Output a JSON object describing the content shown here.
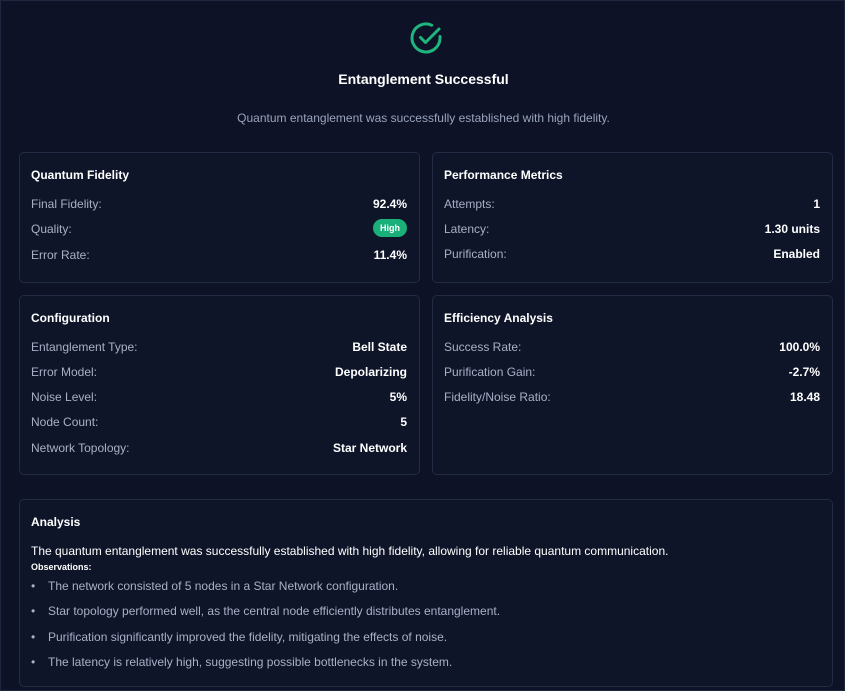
{
  "header": {
    "icon": "check-circle-icon",
    "title": "Entanglement Successful",
    "subtitle": "Quantum entanglement was successfully established with high fidelity."
  },
  "colors": {
    "accent": "#1fb57e",
    "background": "#0d1226",
    "card": "#0f1529"
  },
  "quantum_fidelity": {
    "title": "Quantum Fidelity",
    "rows": [
      {
        "label": "Final Fidelity:",
        "value": "92.4%"
      },
      {
        "label": "Quality:",
        "value": "High"
      },
      {
        "label": "Error Rate:",
        "value": "11.4%"
      }
    ]
  },
  "performance_metrics": {
    "title": "Performance Metrics",
    "rows": [
      {
        "label": "Attempts:",
        "value": "1"
      },
      {
        "label": "Latency:",
        "value": "1.30 units"
      },
      {
        "label": "Purification:",
        "value": "Enabled"
      }
    ]
  },
  "configuration": {
    "title": "Configuration",
    "rows": [
      {
        "label": "Entanglement Type:",
        "value": "Bell State"
      },
      {
        "label": "Error Model:",
        "value": "Depolarizing"
      },
      {
        "label": "Noise Level:",
        "value": "5%"
      },
      {
        "label": "Node Count:",
        "value": "5"
      },
      {
        "label": "Network Topology:",
        "value": "Star Network"
      }
    ]
  },
  "efficiency_analysis": {
    "title": "Efficiency Analysis",
    "rows": [
      {
        "label": "Success Rate:",
        "value": "100.0%"
      },
      {
        "label": "Purification Gain:",
        "value": "-2.7%"
      },
      {
        "label": "Fidelity/Noise Ratio:",
        "value": "18.48"
      }
    ]
  },
  "analysis": {
    "title": "Analysis",
    "lead": "The quantum entanglement was successfully established with high fidelity, allowing for reliable quantum communication.",
    "observations_label": "Observations:",
    "observations": [
      "The network consisted of 5 nodes in a Star Network configuration.",
      "Star topology performed well, as the central node efficiently distributes entanglement.",
      "Purification significantly improved the fidelity, mitigating the effects of noise.",
      "The latency is relatively high, suggesting possible bottlenecks in the system."
    ]
  }
}
